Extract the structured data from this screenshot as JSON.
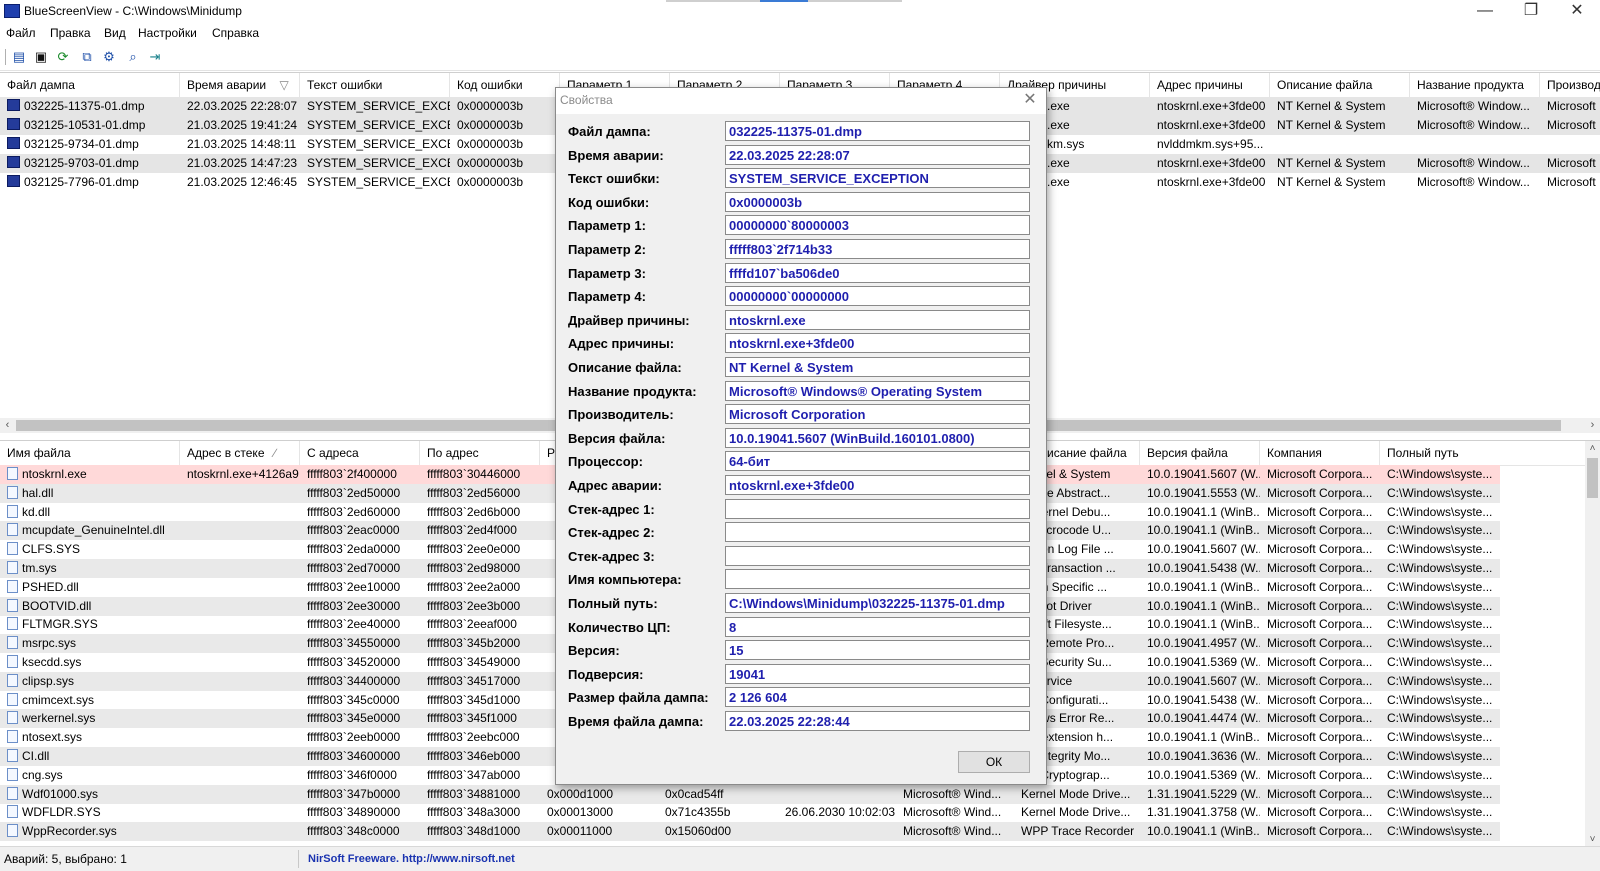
{
  "window": {
    "title": "BlueScreenView  -  C:\\Windows\\Minidump",
    "minimize": "—",
    "maximize": "❐",
    "close": "✕"
  },
  "menu": [
    "Файл",
    "Правка",
    "Вид",
    "Настройки",
    "Справка"
  ],
  "toolbar_icons": [
    "properties-icon",
    "save-icon",
    "refresh-icon",
    "copy-icon",
    "options-icon",
    "find-icon",
    "exit-icon"
  ],
  "top_table": {
    "columns": [
      "Файл дампа",
      "Время аварии",
      "Текст ошибки",
      "Код ошибки",
      "Параметр 1",
      "Параметр 2",
      "Параметр 3",
      "Параметр 4",
      "Драйвер причины",
      "Адрес причины",
      "Описание файла",
      "Название продукта",
      "Производ"
    ],
    "sort_indicator": "▽",
    "rows": [
      {
        "file": "032225-11375-01.dmp",
        "time": "22.03.2025 22:28:07",
        "text": "SYSTEM_SERVICE_EXCEP...",
        "code": "0x0000003b",
        "driver": ".exe",
        "addr": "ntoskrnl.exe+3fde00",
        "desc": "NT Kernel & System",
        "product": "Microsoft® Window...",
        "company": "Microsoft"
      },
      {
        "file": "032125-10531-01.dmp",
        "time": "21.03.2025 19:41:24",
        "text": "SYSTEM_SERVICE_EXCEP...",
        "code": "0x0000003b",
        "driver": ".exe",
        "addr": "ntoskrnl.exe+3fde00",
        "desc": "NT Kernel & System",
        "product": "Microsoft® Window...",
        "company": "Microsoft"
      },
      {
        "file": "032125-9734-01.dmp",
        "time": "21.03.2025 14:48:11",
        "text": "SYSTEM_SERVICE_EXCEP...",
        "code": "0x0000003b",
        "driver": "km.sys",
        "addr": "nvlddmkm.sys+95...",
        "desc": "",
        "product": "",
        "company": ""
      },
      {
        "file": "032125-9703-01.dmp",
        "time": "21.03.2025 14:47:23",
        "text": "SYSTEM_SERVICE_EXCEP...",
        "code": "0x0000003b",
        "driver": ".exe",
        "addr": "ntoskrnl.exe+3fde00",
        "desc": "NT Kernel & System",
        "product": "Microsoft® Window...",
        "company": "Microsoft"
      },
      {
        "file": "032125-7796-01.dmp",
        "time": "21.03.2025 12:46:45",
        "text": "SYSTEM_SERVICE_EXCEP...",
        "code": "0x0000003b",
        "driver": ".exe",
        "addr": "ntoskrnl.exe+3fde00",
        "desc": "NT Kernel & System",
        "product": "Microsoft® Window...",
        "company": "Microsoft"
      }
    ]
  },
  "bottom_table": {
    "columns": [
      "Имя файла",
      "Адрес в стеке",
      "С адреса",
      "По адрес",
      "Р",
      "исание файла",
      "Версия файла",
      "Компания",
      "Полный путь"
    ],
    "sort_indicator": "∕",
    "rows": [
      {
        "name": "ntoskrnl.exe",
        "stack": "ntoskrnl.exe+4126a9",
        "from": "fffff803`2f400000",
        "to": "fffff803`30446000",
        "size": "",
        "stamp": "",
        "date": "",
        "product": "",
        "desc": "Kernel & System",
        "ver": "10.0.19041.5607 (W...",
        "company": "Microsoft Corpora...",
        "path": "C:\\Windows\\syste..."
      },
      {
        "name": "hal.dll",
        "stack": "",
        "from": "fffff803`2ed50000",
        "to": "fffff803`2ed56000",
        "size": "",
        "stamp": "",
        "date": "",
        "product": "",
        "desc": "dware Abstract...",
        "ver": "10.0.19041.5553 (W...",
        "company": "Microsoft Corpora...",
        "path": "C:\\Windows\\syste..."
      },
      {
        "name": "kd.dll",
        "stack": "",
        "from": "fffff803`2ed60000",
        "to": "fffff803`2ed6b000",
        "size": "",
        "stamp": "",
        "date": "",
        "product": "",
        "desc": "al Kernel Debu...",
        "ver": "10.0.19041.1 (WinB...",
        "company": "Microsoft Corpora...",
        "path": "C:\\Windows\\syste..."
      },
      {
        "name": "mcupdate_GenuineIntel.dll",
        "stack": "",
        "from": "fffff803`2eac0000",
        "to": "fffff803`2ed4f000",
        "size": "",
        "stamp": "",
        "date": "",
        "product": "",
        "desc": "el Microcode U...",
        "ver": "10.0.19041.1 (WinB...",
        "company": "Microsoft Corpora...",
        "path": "C:\\Windows\\syste..."
      },
      {
        "name": "CLFS.SYS",
        "stack": "",
        "from": "fffff803`2eda0000",
        "to": "fffff803`2ee0e000",
        "size": "",
        "stamp": "",
        "date": "",
        "product": "",
        "desc": "mmon Log File ...",
        "ver": "10.0.19041.5607 (W...",
        "company": "Microsoft Corpora...",
        "path": "C:\\Windows\\syste..."
      },
      {
        "name": "tm.sys",
        "stack": "",
        "from": "fffff803`2ed70000",
        "to": "fffff803`2ed98000",
        "size": "",
        "stamp": "",
        "date": "",
        "product": "",
        "desc": "nel Transaction ...",
        "ver": "10.0.19041.5438 (W...",
        "company": "Microsoft Corpora...",
        "path": "C:\\Windows\\syste..."
      },
      {
        "name": "PSHED.dll",
        "stack": "",
        "from": "fffff803`2ee10000",
        "to": "fffff803`2ee2a000",
        "size": "",
        "stamp": "",
        "date": "",
        "product": "",
        "desc": "tform Specific ...",
        "ver": "10.0.19041.1 (WinB...",
        "company": "Microsoft Corpora...",
        "path": "C:\\Windows\\syste..."
      },
      {
        "name": "BOOTVID.dll",
        "stack": "",
        "from": "fffff803`2ee30000",
        "to": "fffff803`2ee3b000",
        "size": "",
        "stamp": "",
        "date": "",
        "product": "",
        "desc": "A Boot Driver",
        "ver": "10.0.19041.1 (WinB...",
        "company": "Microsoft Corpora...",
        "path": "C:\\Windows\\syste..."
      },
      {
        "name": "FLTMGR.SYS",
        "stack": "",
        "from": "fffff803`2ee40000",
        "to": "fffff803`2eeaf000",
        "size": "",
        "stamp": "",
        "date": "",
        "product": "",
        "desc": "rosoft Filesyste...",
        "ver": "10.0.19041.1 (WinB...",
        "company": "Microsoft Corpora...",
        "path": "C:\\Windows\\syste..."
      },
      {
        "name": "msrpc.sys",
        "stack": "",
        "from": "fffff803`34550000",
        "to": "fffff803`345b2000",
        "size": "",
        "stamp": "",
        "date": "",
        "product": "",
        "desc": "nel Remote Pro...",
        "ver": "10.0.19041.4957 (W...",
        "company": "Microsoft Corpora...",
        "path": "C:\\Windows\\syste..."
      },
      {
        "name": "ksecdd.sys",
        "stack": "",
        "from": "fffff803`34520000",
        "to": "fffff803`34549000",
        "size": "",
        "stamp": "",
        "date": "",
        "product": "",
        "desc": "nel Security Su...",
        "ver": "10.0.19041.5369 (W...",
        "company": "Microsoft Corpora...",
        "path": "C:\\Windows\\syste..."
      },
      {
        "name": "clipsp.sys",
        "stack": "",
        "from": "fffff803`34400000",
        "to": "fffff803`34517000",
        "size": "",
        "stamp": "",
        "date": "",
        "product": "",
        "desc": "P Service",
        "ver": "10.0.19041.5607 (W...",
        "company": "Microsoft Corpora...",
        "path": "C:\\Windows\\syste..."
      },
      {
        "name": "cmimcext.sys",
        "stack": "",
        "from": "fffff803`345c0000",
        "to": "fffff803`345d1000",
        "size": "",
        "stamp": "",
        "date": "",
        "product": "",
        "desc": "nel Configurati...",
        "ver": "10.0.19041.5438 (W...",
        "company": "Microsoft Corpora...",
        "path": "C:\\Windows\\syste..."
      },
      {
        "name": "werkernel.sys",
        "stack": "",
        "from": "fffff803`345e0000",
        "to": "fffff803`345f1000",
        "size": "",
        "stamp": "",
        "date": "",
        "product": "",
        "desc": "ndows Error Re...",
        "ver": "10.0.19041.4474 (W...",
        "company": "Microsoft Corpora...",
        "path": "C:\\Windows\\syste..."
      },
      {
        "name": "ntosext.sys",
        "stack": "",
        "from": "fffff803`2eeb0000",
        "to": "fffff803`2eebc000",
        "size": "",
        "stamp": "",
        "date": "",
        "product": "",
        "desc": "OS extension h...",
        "ver": "10.0.19041.1 (WinB...",
        "company": "Microsoft Corpora...",
        "path": "C:\\Windows\\syste..."
      },
      {
        "name": "CI.dll",
        "stack": "",
        "from": "fffff803`34600000",
        "to": "fffff803`346eb000",
        "size": "",
        "stamp": "",
        "date": "",
        "product": "",
        "desc": "de Integrity Mo...",
        "ver": "10.0.19041.3636 (W...",
        "company": "Microsoft Corpora...",
        "path": "C:\\Windows\\syste..."
      },
      {
        "name": "cng.sys",
        "stack": "",
        "from": "fffff803`346f0000",
        "to": "fffff803`347ab000",
        "size": "",
        "stamp": "",
        "date": "",
        "product": "",
        "desc": "nel Cryptograp...",
        "ver": "10.0.19041.5369 (W...",
        "company": "Microsoft Corpora...",
        "path": "C:\\Windows\\syste..."
      },
      {
        "name": "Wdf01000.sys",
        "stack": "",
        "from": "fffff803`347b0000",
        "to": "fffff803`34881000",
        "size": "0x000d1000",
        "stamp": "0x0cad54ff",
        "date": "",
        "product": "Microsoft® Wind...",
        "desc": "Kernel Mode Drive...",
        "ver": "1.31.19041.5229 (W...",
        "company": "Microsoft Corpora...",
        "path": "C:\\Windows\\syste..."
      },
      {
        "name": "WDFLDR.SYS",
        "stack": "",
        "from": "fffff803`34890000",
        "to": "fffff803`348a3000",
        "size": "0x00013000",
        "stamp": "0x71c4355b",
        "date": "26.06.2030 10:02:03",
        "product": "Microsoft® Wind...",
        "desc": "Kernel Mode Drive...",
        "ver": "1.31.19041.3758 (W...",
        "company": "Microsoft Corpora...",
        "path": "C:\\Windows\\syste..."
      },
      {
        "name": "WppRecorder.sys",
        "stack": "",
        "from": "fffff803`348c0000",
        "to": "fffff803`348d1000",
        "size": "0x00011000",
        "stamp": "0x15060d00",
        "date": "",
        "product": "Microsoft® Wind...",
        "desc": "WPP Trace Recorder",
        "ver": "10.0.19041.1 (WinB...",
        "company": "Microsoft Corpora...",
        "path": "C:\\Windows\\syste..."
      }
    ]
  },
  "status": {
    "left": "Аварий: 5, выбрано: 1",
    "right": "NirSoft Freeware.  http://www.nirsoft.net"
  },
  "dialog": {
    "title": "Свойства",
    "close": "✕",
    "ok": "ОК",
    "fields": [
      {
        "label": "Файл дампа:",
        "value": "032225-11375-01.dmp"
      },
      {
        "label": "Время аварии:",
        "value": "22.03.2025 22:28:07"
      },
      {
        "label": "Текст ошибки:",
        "value": "SYSTEM_SERVICE_EXCEPTION"
      },
      {
        "label": "Код ошибки:",
        "value": "0x0000003b"
      },
      {
        "label": "Параметр 1:",
        "value": "00000000`80000003"
      },
      {
        "label": "Параметр 2:",
        "value": "fffff803`2f714b33"
      },
      {
        "label": "Параметр 3:",
        "value": "ffffd107`ba506de0"
      },
      {
        "label": "Параметр 4:",
        "value": "00000000`00000000"
      },
      {
        "label": "Драйвер причины:",
        "value": "ntoskrnl.exe"
      },
      {
        "label": "Адрес причины:",
        "value": "ntoskrnl.exe+3fde00"
      },
      {
        "label": "Описание файла:",
        "value": "NT Kernel & System"
      },
      {
        "label": "Название продукта:",
        "value": "Microsoft® Windows® Operating System"
      },
      {
        "label": "Производитель:",
        "value": "Microsoft Corporation"
      },
      {
        "label": "Версия файла:",
        "value": "10.0.19041.5607 (WinBuild.160101.0800)"
      },
      {
        "label": "Процессор:",
        "value": "64-бит"
      },
      {
        "label": "Адрес аварии:",
        "value": "ntoskrnl.exe+3fde00"
      },
      {
        "label": "Стек-адрес 1:",
        "value": ""
      },
      {
        "label": "Стек-адрес 2:",
        "value": ""
      },
      {
        "label": "Стек-адрес 3:",
        "value": ""
      },
      {
        "label": "Имя компьютера:",
        "value": ""
      },
      {
        "label": "Полный путь:",
        "value": "C:\\Windows\\Minidump\\032225-11375-01.dmp"
      },
      {
        "label": "Количество ЦП:",
        "value": "8"
      },
      {
        "label": "Версия:",
        "value": "15"
      },
      {
        "label": "Подверсия:",
        "value": "19041"
      },
      {
        "label": "Размер файла дампа:",
        "value": "2  126  604"
      },
      {
        "label": "Время файла дампа:",
        "value": "22.03.2025 22:28:44"
      }
    ]
  },
  "colors": {
    "selected_row": "#e5e5e5",
    "highlight_row": "#ffd9d9",
    "dialog_value_text": "#1f1fae",
    "status_link": "#1a33b0"
  }
}
